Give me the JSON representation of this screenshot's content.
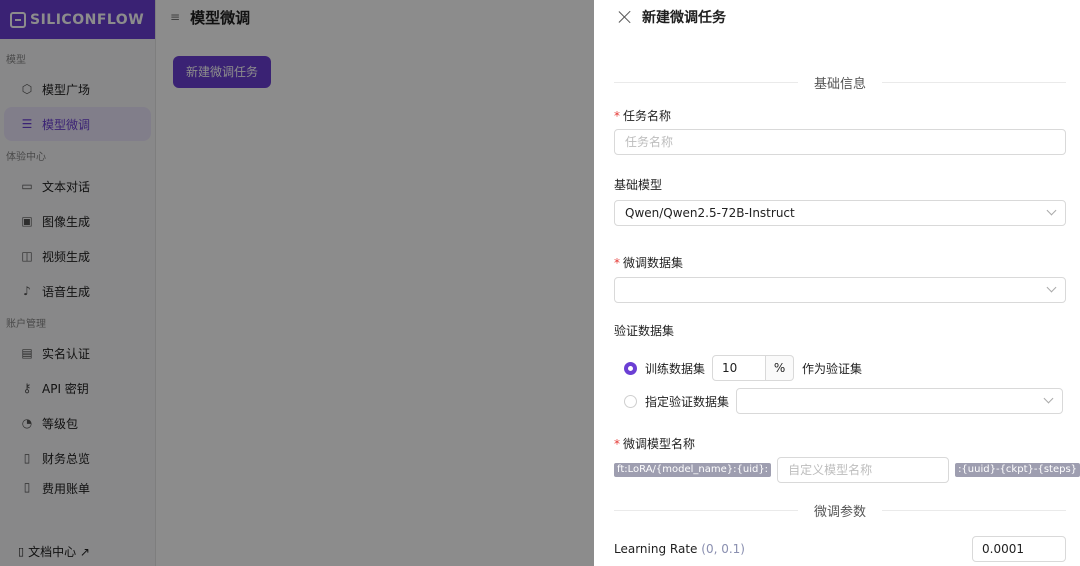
{
  "sidebar": {
    "logo_text": "SILICONFLOW",
    "groups": {
      "models": "模型",
      "experience": "体验中心",
      "account": "账户管理"
    },
    "items": {
      "model_square": "模型广场",
      "finetune": "模型微调",
      "text_chat": "文本对话",
      "image_gen": "图像生成",
      "video_gen": "视频生成",
      "voice_gen": "语音生成",
      "real_name": "实名认证",
      "api_key": "API 密钥",
      "tier": "等级包",
      "finance": "财务总览",
      "bills": "费用账单"
    },
    "docs": "文档中心 ↗"
  },
  "main": {
    "title": "模型微调",
    "new_button": "新建微调任务"
  },
  "drawer": {
    "title": "新建微调任务",
    "basic_section": "基础信息",
    "task_name_label": "任务名称",
    "task_name_placeholder": "任务名称",
    "base_model_label": "基础模型",
    "base_model_value": "Qwen/Qwen2.5-72B-Instruct",
    "dataset_label": "微调数据集",
    "validation_label": "验证数据集",
    "validation_option1": "训练数据集",
    "validation_percent": "10",
    "percent_suffix": "%",
    "validation_after": "作为验证集",
    "validation_option2": "指定验证数据集",
    "finetuned_name_label": "微调模型名称",
    "name_prefix": "ft:LoRA/{model_name}:{uid}:",
    "name_placeholder": "自定义模型名称",
    "name_suffix": ":{uuid}-{ckpt}-{steps}",
    "params_section": "微调参数",
    "learning_rate_label": "Learning Rate",
    "learning_rate_range": "(0, 0.1)",
    "learning_rate_value": "0.0001"
  }
}
